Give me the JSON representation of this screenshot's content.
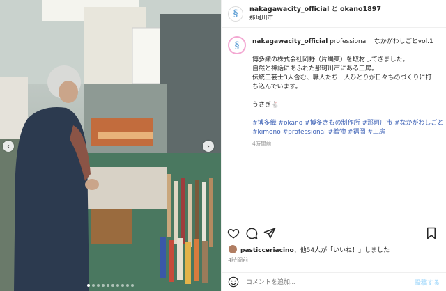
{
  "header": {
    "account": "nakagawacity_official",
    "connector": "と",
    "collaborator": "okano1897",
    "location": "那珂川市"
  },
  "caption": {
    "username": "nakagawacity_official",
    "first_line_rest": "professional　なかがわしごとvol.1",
    "lines": [
      "博多織の株式会社岡野（片縄東）を取材してきました。",
      "自然と神話にあふれた那珂川市にある工房。",
      "伝統工芸士3人含む、職人たち一人ひとりが日々ものづくりに打",
      "ち込んでいます。"
    ],
    "sign": "うさぎ🐇",
    "hashtags_line1": "#博多織 #okano #博多きもの制作所 #那珂川市 #なかがわしごと",
    "hashtags_line2": "#kimono #professional #着物 #福岡 #工房",
    "time": "4時間前"
  },
  "likes": {
    "user": "pasticceriacino",
    "rest": "、他54人が「いいね！」しました"
  },
  "post_time": "4時間前",
  "comment": {
    "placeholder": "コメントを追加...",
    "post_label": "投稿する"
  },
  "carousel": {
    "count": 10,
    "active": 0
  },
  "icons": {
    "like": "heart-icon",
    "comment": "comment-icon",
    "share": "share-icon",
    "save": "bookmark-icon",
    "emoji": "emoji-icon"
  }
}
